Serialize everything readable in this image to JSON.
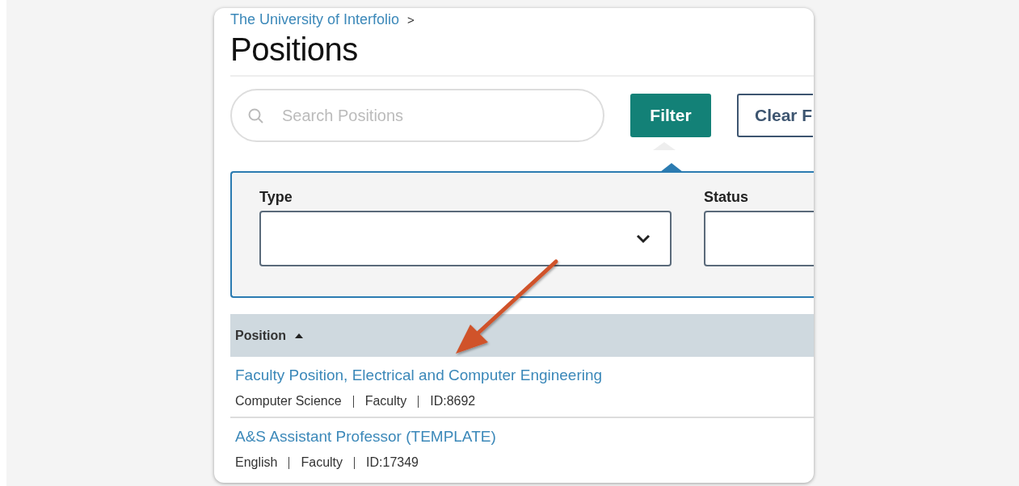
{
  "breadcrumb": {
    "label": "The University of Interfolio",
    "separator": ">"
  },
  "title": "Positions",
  "search": {
    "placeholder": "Search Positions"
  },
  "buttons": [
    {
      "kind": "primary",
      "label": "Filter"
    },
    {
      "kind": "outline",
      "label": "Clear F"
    }
  ],
  "filter_panel": {
    "open": true,
    "fields": [
      {
        "label": "Type",
        "kind": "select"
      },
      {
        "label": "Status",
        "kind": "select"
      }
    ]
  },
  "table": {
    "columns": [
      {
        "label": "Position",
        "sort_ascending": true
      }
    ],
    "rows": [
      {
        "title": "Faculty Position, Electrical and Computer Engineering",
        "meta": [
          "Computer Science",
          "Faculty",
          "ID:8692"
        ]
      },
      {
        "title": "A&S Assistant Professor (TEMPLATE)",
        "meta": [
          "English",
          "Faculty",
          "ID:17349"
        ]
      }
    ]
  },
  "annotation": {
    "kind": "arrow"
  }
}
